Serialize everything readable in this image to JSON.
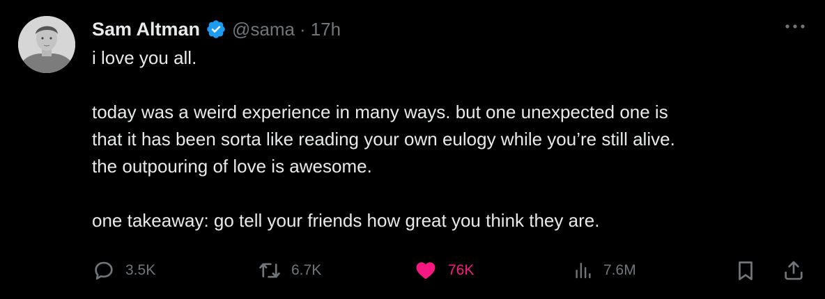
{
  "tweet": {
    "author_name": "Sam Altman",
    "handle": "@sama",
    "separator": "·",
    "time": "17h",
    "verified": true,
    "lines": [
      "i love you all.",
      "",
      "today was a weird experience in many ways. but one unexpected one is",
      "that it has been sorta like reading your own eulogy while you’re still alive.",
      "the outpouring of love is awesome.",
      "",
      "one takeaway: go tell your friends how great you think they are."
    ]
  },
  "actions": {
    "replies": "3.5K",
    "reposts": "6.7K",
    "likes": "76K",
    "views": "7.6M"
  },
  "colors": {
    "background": "#000000",
    "text": "#e7e9ea",
    "muted": "#71767b",
    "verified": "#1d9bf0",
    "liked": "#f91880"
  }
}
